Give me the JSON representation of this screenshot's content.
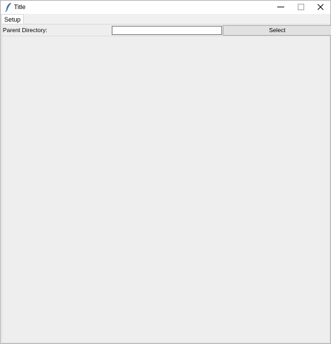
{
  "window": {
    "title": "Title",
    "controls": [
      "minimize-icon",
      "maximize-icon",
      "close-icon"
    ],
    "app_icon": "feather-icon"
  },
  "tabs": [
    {
      "label": "Setup",
      "active": true
    }
  ],
  "setup": {
    "parent_directory_label": "Parent Directory:",
    "parent_directory_value": "",
    "select_button_label": "Select"
  },
  "colors": {
    "window_bg": "#f0f0f0",
    "titlebar_bg": "#ffffff",
    "button_bg": "#e1e1e1"
  }
}
